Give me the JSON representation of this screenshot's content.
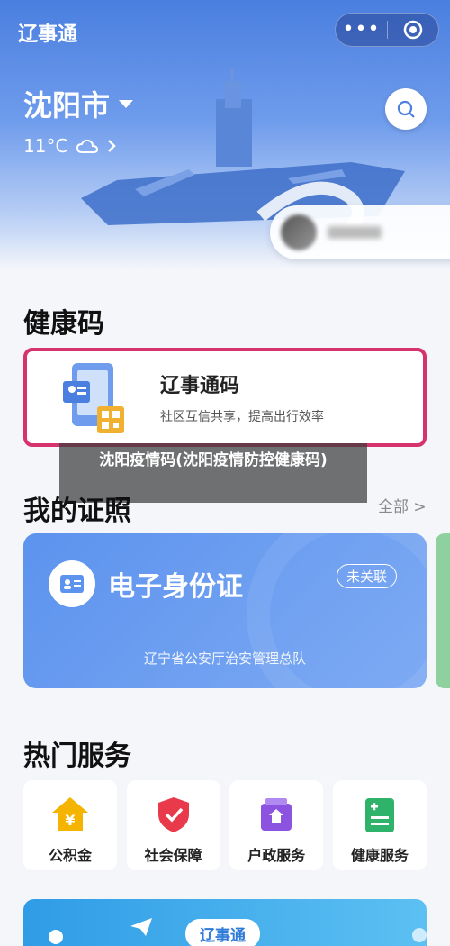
{
  "header": {
    "app_title": "辽事通",
    "city": "沈阳市",
    "weather": "11°C",
    "more_icon": "more-dots-icon",
    "target_icon": "target-circle-icon",
    "search_icon": "search-icon"
  },
  "health_code": {
    "section_title": "健康码",
    "card_title": "辽事通码",
    "card_subtitle": "社区互信共享，提高出行效率"
  },
  "overlay_caption": "沈阳疫情码(沈阳疫情防控健康码)",
  "certificates": {
    "section_title": "我的证照",
    "see_all": "全部 >",
    "id_card_title": "电子身份证",
    "id_badge": "未关联",
    "id_issuer": "辽宁省公安厅治安管理总队"
  },
  "services": {
    "section_title": "热门服务",
    "items": [
      {
        "label": "公积金",
        "icon": "house-yen-icon",
        "color": "#f5b400"
      },
      {
        "label": "社会保障",
        "icon": "shield-check-icon",
        "color": "#e83a4a"
      },
      {
        "label": "户政服务",
        "icon": "id-house-icon",
        "color": "#8c52e0"
      },
      {
        "label": "健康服务",
        "icon": "medical-kit-icon",
        "color": "#2fb36a"
      }
    ]
  },
  "bottom_banner": {
    "label": "辽事通"
  },
  "colors": {
    "primary": "#4a7fe0",
    "highlight_border": "#d6336c"
  }
}
